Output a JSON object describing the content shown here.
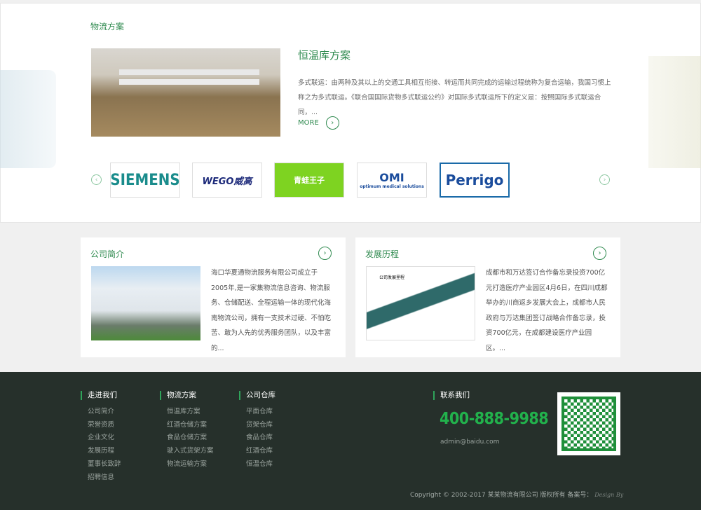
{
  "solutions": {
    "section_title": "物流方案",
    "title": "恒温库方案",
    "description": "多式联运：由两种及其以上的交通工具相互衔接、转运而共同完成的运输过程统称为复合运输，我国习惯上称之为多式联运。《联合国国际货物多式联运公约》对国际多式联运所下的定义是：按照国际多式联运合同，...",
    "more": "MORE"
  },
  "partners": [
    "SIEMENS",
    "WEGO威高",
    "青蛙王子",
    "optimum medical solutions",
    "Perrigo"
  ],
  "about": {
    "title": "公司简介",
    "text": "海口华夏通物流服务有限公司成立于2005年,是一家集物流信息咨询、物流服务、仓储配送、全程运输一体的现代化海南物流公司，拥有一支技术过硬、不怕吃苦、敢为人先的优秀服务团队，以及丰富的..."
  },
  "history": {
    "title": "发展历程",
    "text": "成都市和万达签订合作备忘录投资700亿元打造医疗产业园区4月6日，在四川成都举办的川商返乡发展大会上，成都市人民政府与万达集团签订战略合作备忘录，投资700亿元，在成都建设医疗产业园区。...",
    "image_caption": "公司发展里程"
  },
  "footer": {
    "cols": [
      {
        "title": "走进我们",
        "items": [
          "公司简介",
          "荣誉资质",
          "企业文化",
          "发展历程",
          "董事长致辞",
          "招聘信息"
        ]
      },
      {
        "title": "物流方案",
        "items": [
          "恒温库方案",
          "红酒仓储方案",
          "食品仓储方案",
          "驶入式货架方案",
          "物流运输方案"
        ]
      },
      {
        "title": "公司仓库",
        "items": [
          "平面仓库",
          "货架仓库",
          "食品仓库",
          "红酒仓库",
          "恒温仓库"
        ]
      }
    ],
    "contact_title": "联系我们",
    "phone": "400-888-9988",
    "email": "admin@baidu.com",
    "copyright": "Copyright © 2002-2017 某某物流有限公司 版权所有 备案号：",
    "design": "Design By"
  },
  "colors": {
    "accent": "#2f8a4f",
    "footer_bg": "#26302b",
    "phone": "#22b14c"
  }
}
